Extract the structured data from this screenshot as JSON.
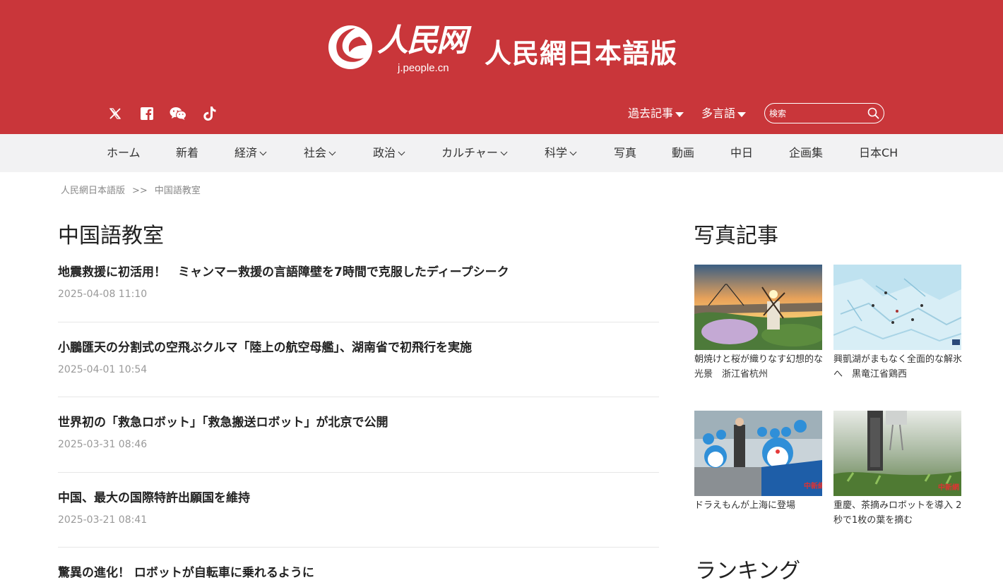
{
  "header": {
    "logo_chars": "人民网",
    "logo_url": "j.people.cn",
    "site_title": "人民網日本語版",
    "menus": [
      {
        "label": "過去記事"
      },
      {
        "label": "多言語"
      }
    ],
    "search": {
      "placeholder": "検索",
      "value": ""
    },
    "social_icons": [
      "x-icon",
      "facebook-icon",
      "wechat-icon",
      "tiktok-icon"
    ],
    "color": "#c9363a"
  },
  "nav": {
    "items": [
      {
        "label": "ホーム",
        "dropdown": false
      },
      {
        "label": "新着",
        "dropdown": false
      },
      {
        "label": "経済",
        "dropdown": true
      },
      {
        "label": "社会",
        "dropdown": true
      },
      {
        "label": "政治",
        "dropdown": true
      },
      {
        "label": "カルチャー",
        "dropdown": true
      },
      {
        "label": "科学",
        "dropdown": true
      },
      {
        "label": "写真",
        "dropdown": false
      },
      {
        "label": "動画",
        "dropdown": false
      },
      {
        "label": "中日",
        "dropdown": false
      },
      {
        "label": "企画集",
        "dropdown": false
      },
      {
        "label": "日本CH",
        "dropdown": false
      }
    ]
  },
  "breadcrumb": {
    "home": "人民網日本語版",
    "separator": ">>",
    "current": "中国語教室"
  },
  "main": {
    "title": "中国語教室",
    "articles": [
      {
        "title": "地震救援に初活用！　ミャンマー救援の言語障壁を7時間で克服したディープシーク",
        "date": "2025-04-08 11:10"
      },
      {
        "title": "小鵬匯天の分割式の空飛ぶクルマ「陸上の航空母艦」、湖南省で初飛行を実施",
        "date": "2025-04-01 10:54"
      },
      {
        "title": "世界初の「救急ロボット」「救急搬送ロボット」が北京で公開",
        "date": "2025-03-31 08:46"
      },
      {
        "title": "中国、最大の国際特許出願国を維持",
        "date": "2025-03-21 08:41"
      },
      {
        "title": "驚異の進化！ ロボットが自転車に乗れるように",
        "date": ""
      }
    ]
  },
  "sidebar": {
    "photo_title": "写真記事",
    "photos": [
      {
        "caption": "朝焼けと桜が織りなす幻想的な光景　浙江省杭州"
      },
      {
        "caption": "興凱湖がまもなく全面的な解氷へ　黒竜江省鶏西"
      },
      {
        "caption": "ドラえもんが上海に登場"
      },
      {
        "caption": "重慶、茶摘みロボットを導入 2秒で1枚の葉を摘む"
      }
    ],
    "ranking_title": "ランキング"
  }
}
